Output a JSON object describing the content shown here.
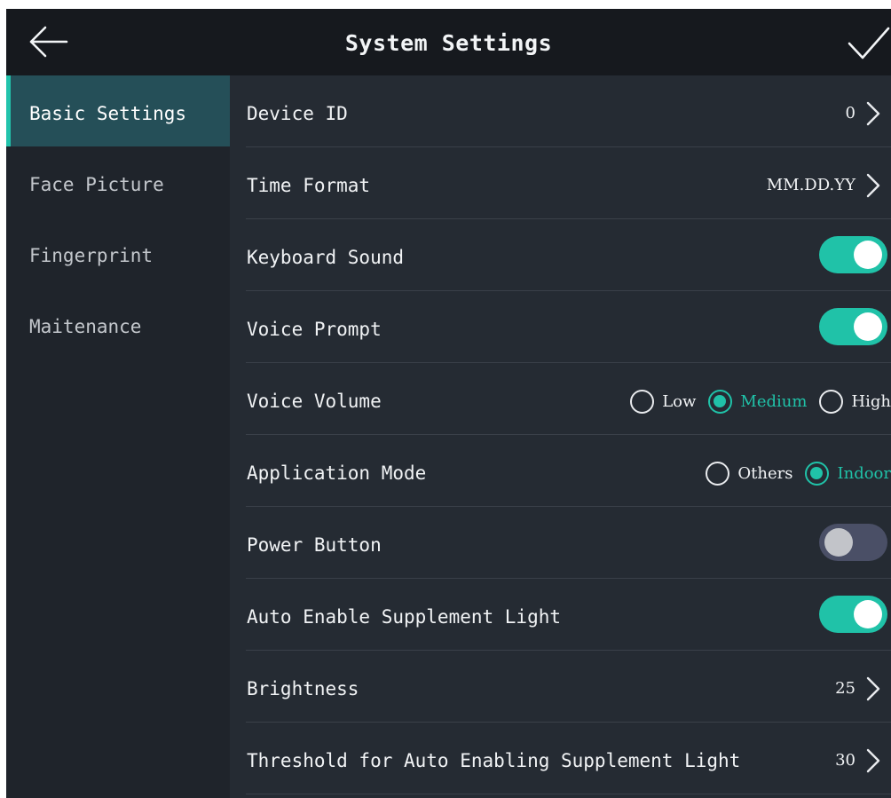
{
  "header": {
    "title": "System Settings"
  },
  "sidebar": {
    "items": [
      {
        "label": "Basic Settings",
        "active": true
      },
      {
        "label": "Face Picture",
        "active": false
      },
      {
        "label": "Fingerprint",
        "active": false
      },
      {
        "label": "Maitenance",
        "active": false
      }
    ]
  },
  "settings": {
    "device_id": {
      "label": "Device ID",
      "value": "0"
    },
    "time_format": {
      "label": "Time Format",
      "value": "MM.DD.YY"
    },
    "keyboard_sound": {
      "label": "Keyboard Sound",
      "enabled": true
    },
    "voice_prompt": {
      "label": "Voice Prompt",
      "enabled": true
    },
    "voice_volume": {
      "label": "Voice Volume",
      "options": [
        "Low",
        "Medium",
        "High"
      ],
      "selected": "Medium"
    },
    "application_mode": {
      "label": "Application Mode",
      "options": [
        "Others",
        "Indoor"
      ],
      "selected": "Indoor"
    },
    "power_button": {
      "label": "Power Button",
      "enabled": false
    },
    "auto_supplement_light": {
      "label": "Auto Enable Supplement Light",
      "enabled": true
    },
    "brightness": {
      "label": "Brightness",
      "value": "25"
    },
    "threshold": {
      "label": "Threshold for Auto Enabling Supplement Light",
      "value": "30"
    }
  },
  "icons": {
    "back": "arrow-left-icon",
    "confirm": "checkmark-icon",
    "chevron": "chevron-right-icon"
  },
  "colors": {
    "accent": "#20c2a8",
    "header_bg": "#16191e",
    "sidebar_bg": "#1f242b",
    "sidebar_active_bg": "#254f58",
    "content_bg": "#252b33",
    "toggle_off": "#4a4f66"
  }
}
